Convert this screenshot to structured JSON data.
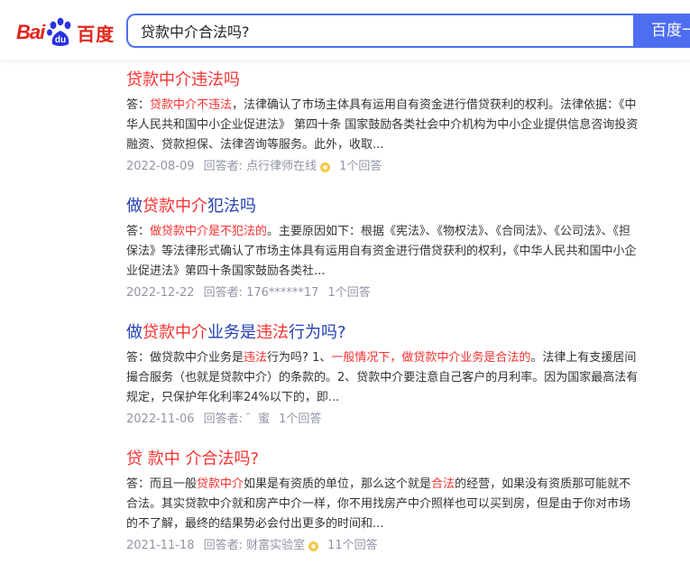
{
  "header": {
    "logo_bai": "Bai",
    "logo_du": "du",
    "logo_cn": "百度",
    "query": "贷款中介合法吗?",
    "search_button": "百度一"
  },
  "results": [
    {
      "title_parts": [
        {
          "t": "贷款中介违法吗",
          "red": true
        }
      ],
      "abstract_parts": [
        {
          "t": "答：",
          "red": false
        },
        {
          "t": "贷款中介不违法",
          "red": true
        },
        {
          "t": "，法律确认了市场主体具有运用自有资金进行借贷获利的权利。法律依据：《中华人民共和国中小企业促进法》 第四十条 国家鼓励各类社会中介机构为中小企业提供信息咨询投资融资、贷款担保、法律咨询等服务。此外，收取...",
          "red": false
        }
      ],
      "date": "2022-08-09",
      "answerer": "回答者: 点行律师在线",
      "has_badge": true,
      "answers": "1个回答"
    },
    {
      "title_parts": [
        {
          "t": "做",
          "red": false
        },
        {
          "t": "贷款中介",
          "red": true
        },
        {
          "t": "犯法吗",
          "red": false
        }
      ],
      "abstract_parts": [
        {
          "t": "答：",
          "red": false
        },
        {
          "t": "做贷款中介是不犯法的",
          "red": true
        },
        {
          "t": "。主要原因如下：根据《宪法》、《物权法》、《合同法》、《公司法》、《担保法》等法律形式确认了市场主体具有运用自有资金进行借贷获利的权利，《中华人民共和国中小企业促进法》第四十条国家鼓励各类社...",
          "red": false
        }
      ],
      "date": "2022-12-22",
      "answerer": "回答者: 176******17",
      "has_badge": false,
      "answers": "1个回答"
    },
    {
      "title_parts": [
        {
          "t": "做",
          "red": false
        },
        {
          "t": "贷款中介",
          "red": true
        },
        {
          "t": "业务是",
          "red": false
        },
        {
          "t": "违法",
          "red": true
        },
        {
          "t": "行为吗?",
          "red": false
        }
      ],
      "abstract_parts": [
        {
          "t": "答：做贷款中介业务是",
          "red": false
        },
        {
          "t": "违法",
          "red": true
        },
        {
          "t": "行为吗? 1、",
          "red": false
        },
        {
          "t": "一般情况下，做贷款中介业务是合法的",
          "red": true
        },
        {
          "t": "。法律上有支援居间撮合服务（也就是贷款中介）的条款的。2、贷款中介要注意自己客户的月利率。因为国家最高法有规定，只保护年化利率24%以下的，即...",
          "red": false
        }
      ],
      "date": "2022-11-06",
      "answerer": "回答者: ゛蜜",
      "has_badge": false,
      "answers": "1个回答"
    },
    {
      "title_parts": [
        {
          "t": "贷 款中 介合法吗?",
          "red": true
        }
      ],
      "abstract_parts": [
        {
          "t": "答：而且一般",
          "red": false
        },
        {
          "t": "贷款中介",
          "red": true
        },
        {
          "t": "如果是有资质的单位，那么这个就是",
          "red": false
        },
        {
          "t": "合法",
          "red": true
        },
        {
          "t": "的经营，如果没有资质那可能就不合法。其实贷款中介就和房产中介一样，你不用找房产中介照样也可以买到房，但是由于你对市场的不了解，最终的结果势必会付出更多的时间和...",
          "red": false
        }
      ],
      "date": "2021-11-18",
      "answerer": "回答者: 财富实验室",
      "has_badge": true,
      "answers": "11个回答"
    }
  ]
}
